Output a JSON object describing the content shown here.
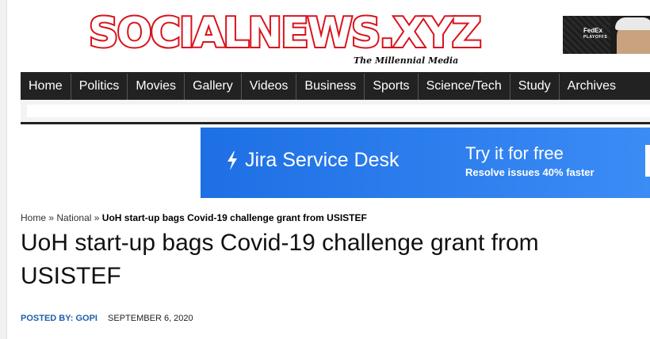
{
  "site": {
    "logo_text": "SOCIALNEWS.XYZ",
    "tagline": "The Millennial Media",
    "logo_color": "#d9121b"
  },
  "top_ad": {
    "brand_line1": "FedEx",
    "brand_line2": "PLAYOFFS"
  },
  "nav": {
    "items": [
      "Home",
      "Politics",
      "Movies",
      "Gallery",
      "Videos",
      "Business",
      "Sports",
      "Science/Tech",
      "Study",
      "Archives"
    ]
  },
  "banner": {
    "brand": "Jira Service Desk",
    "cta": "Try it for free",
    "subtext": "Resolve issues 40% faster",
    "icon": "bolt-icon",
    "bg_color": "#2a7be9"
  },
  "breadcrumb": {
    "home": "Home",
    "section": "National",
    "separator": "»",
    "current": "UoH start-up bags Covid-19 challenge grant from USISTEF"
  },
  "article": {
    "title": "UoH start-up bags Covid-19 challenge grant from USISTEF",
    "posted_by": "POSTED BY: GOPI",
    "date": "SEPTEMBER 6, 2020"
  }
}
